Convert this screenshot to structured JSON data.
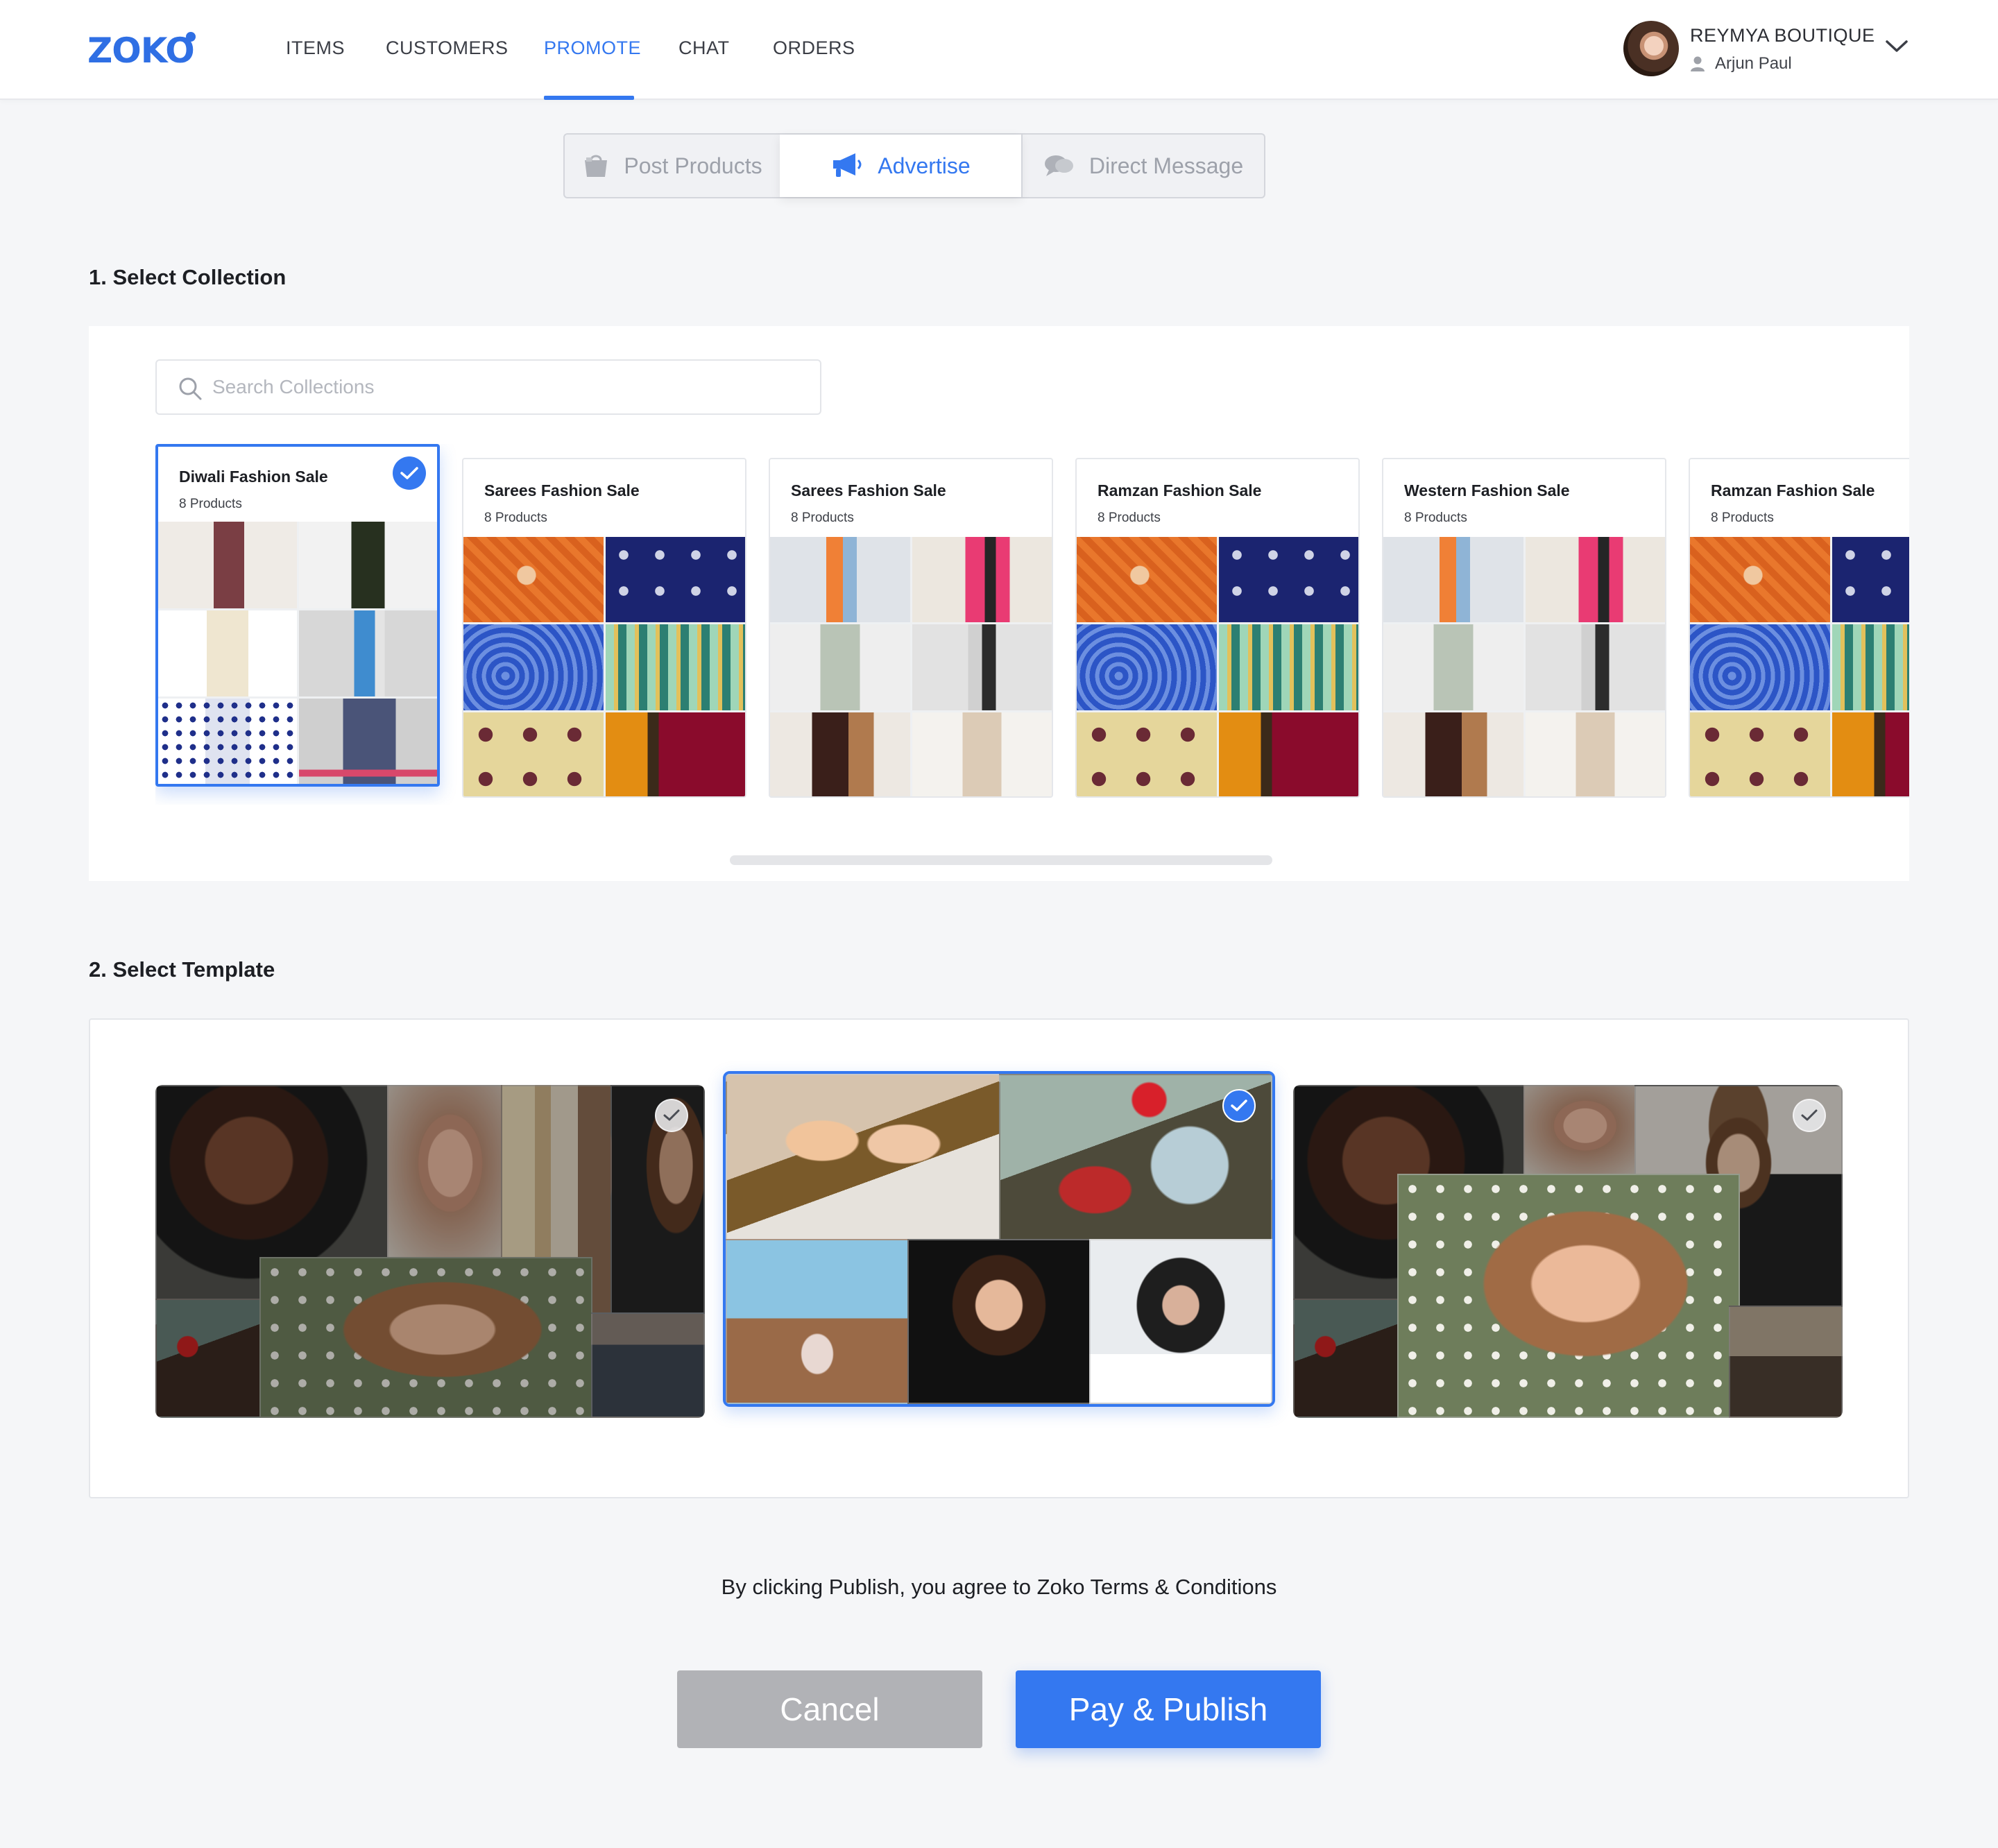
{
  "brand": {
    "name": "ZOKO",
    "accent": "#3478f0"
  },
  "nav": {
    "items": [
      {
        "label": "ITEMS"
      },
      {
        "label": "CUSTOMERS"
      },
      {
        "label": "PROMOTE"
      },
      {
        "label": "CHAT"
      },
      {
        "label": "ORDERS"
      }
    ],
    "active": "PROMOTE"
  },
  "account": {
    "shop_name": "REYMYA BOUTIQUE",
    "user_name": "Arjun Paul"
  },
  "modes": [
    {
      "label": "Post Products",
      "icon": "shopping-bag-icon"
    },
    {
      "label": "Advertise",
      "icon": "megaphone-icon"
    },
    {
      "label": "Direct Message",
      "icon": "chat-bubbles-icon"
    }
  ],
  "active_mode": "Advertise",
  "collection_section": {
    "title": "1. Select Collection",
    "search_placeholder": "Search Collections",
    "collections": [
      {
        "name": "Diwali Fashion Sale",
        "count": "8 Products",
        "selected": true
      },
      {
        "name": "Sarees Fashion Sale",
        "count": "8 Products",
        "selected": false
      },
      {
        "name": "Sarees Fashion Sale",
        "count": "8 Products",
        "selected": false
      },
      {
        "name": "Ramzan Fashion Sale",
        "count": "8 Products",
        "selected": false
      },
      {
        "name": "Western Fashion Sale",
        "count": "8 Products",
        "selected": false
      },
      {
        "name": "Ramzan Fashion Sale",
        "count": "8 Products",
        "selected": false
      }
    ]
  },
  "template_section": {
    "title": "2. Select Template",
    "templates": [
      {
        "selected": false
      },
      {
        "selected": true
      },
      {
        "selected": false
      }
    ]
  },
  "footer": {
    "terms": "By clicking Publish, you agree to Zoko Terms & Conditions",
    "cancel_label": "Cancel",
    "publish_label": "Pay & Publish"
  }
}
